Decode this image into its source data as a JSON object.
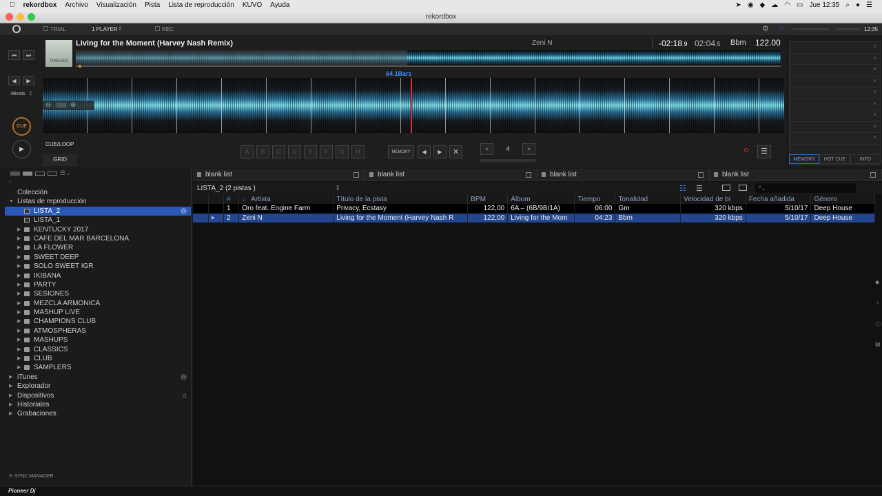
{
  "menubar": {
    "apple_icon": "apple-icon",
    "app": "rekordbox",
    "items": [
      "Archivo",
      "Visualización",
      "Pista",
      "Lista de reproducción",
      "KUVO",
      "Ayuda"
    ],
    "clock": "Jue 12:35"
  },
  "window": {
    "title": "rekordbox"
  },
  "toolbar": {
    "trial": "TRIAL",
    "player_mode": "1 PLAYER",
    "rec": "REC",
    "time": "12:35"
  },
  "deck": {
    "title": "Living for the Moment (Harvey Nash Remix)",
    "artist": "Zeni N",
    "remaining": "-02:18",
    "remaining_frac": ".9",
    "elapsed": "02:04",
    "elapsed_frac": ".5",
    "key": "Bbm",
    "bpm": "122.00",
    "bars_label": "64.1Bars",
    "beats": "4Beats",
    "cue_label": "CUE",
    "cueloop_label": "CUE/LOOP",
    "grid_label": "GRID",
    "pads": [
      "A",
      "B",
      "C",
      "D",
      "E",
      "F",
      "G",
      "H"
    ],
    "memory_label": "MEMORY",
    "beatjump_value": "4",
    "artwork_text": "THDH202",
    "progress": 0.47
  },
  "right_tabs": [
    "MEMORY",
    "HOT CUE",
    "INFO"
  ],
  "sidebar": {
    "collection": "Colección",
    "playlists_header": "Listas de reproducción",
    "playlists": [
      {
        "label": "LISTA_2",
        "type": "list",
        "selected": true
      },
      {
        "label": "LISTA_1",
        "type": "list"
      },
      {
        "label": "KENTUCKY 2017",
        "type": "folder"
      },
      {
        "label": "CAFE DEL MAR BARCELONA",
        "type": "folder"
      },
      {
        "label": "LA FLOWER",
        "type": "folder"
      },
      {
        "label": "SWEET DEEP",
        "type": "folder"
      },
      {
        "label": "SOLO SWEET IGR",
        "type": "folder"
      },
      {
        "label": "IKIBANA",
        "type": "folder"
      },
      {
        "label": "PARTY",
        "type": "folder"
      },
      {
        "label": "SESIONES",
        "type": "folder"
      },
      {
        "label": "MEZCLA ARMONICA",
        "type": "folder"
      },
      {
        "label": "MASHUP LIVE",
        "type": "folder"
      },
      {
        "label": "CHAMPIONS CLUB",
        "type": "folder"
      },
      {
        "label": "ATMOSPHERAS",
        "type": "folder"
      },
      {
        "label": "MASHUPS",
        "type": "folder"
      },
      {
        "label": "CLASSICS",
        "type": "folder"
      },
      {
        "label": "CLUB",
        "type": "folder"
      },
      {
        "label": "SAMPLERS",
        "type": "folder"
      }
    ],
    "others": [
      "iTunes",
      "Explorador",
      "Dispositivos",
      "Historiales",
      "Grabaciones"
    ],
    "sync_manager": "SYNC MANAGER"
  },
  "blank_lists": [
    "blank list",
    "blank list",
    "blank list",
    "blank list"
  ],
  "playlist_header": "LISTA_2 (2 pistas )",
  "table": {
    "columns": [
      "#",
      "Artista",
      "Título de la pista",
      "BPM",
      "Álbum",
      "Tiempo",
      "Tonalidad",
      "Velocidad de bi",
      "Fecha añadida",
      "Género"
    ],
    "rows": [
      [
        "1",
        "Oro feat. Engine Farm",
        "Privacy, Ecstasy",
        "122,00",
        "6A – (6B/9B/1A)",
        "06:00",
        "Gm",
        "320 kbps",
        "5/10/17",
        "Deep House"
      ],
      [
        "2",
        "Zeni N",
        "Living for the Moment (Harvey Nash R",
        "122,00",
        "Living for the Mom",
        "04:23",
        "Bbm",
        "320 kbps",
        "5/10/17",
        "Deep House"
      ]
    ]
  },
  "footer": {
    "brand": "Pioneer Dj"
  }
}
